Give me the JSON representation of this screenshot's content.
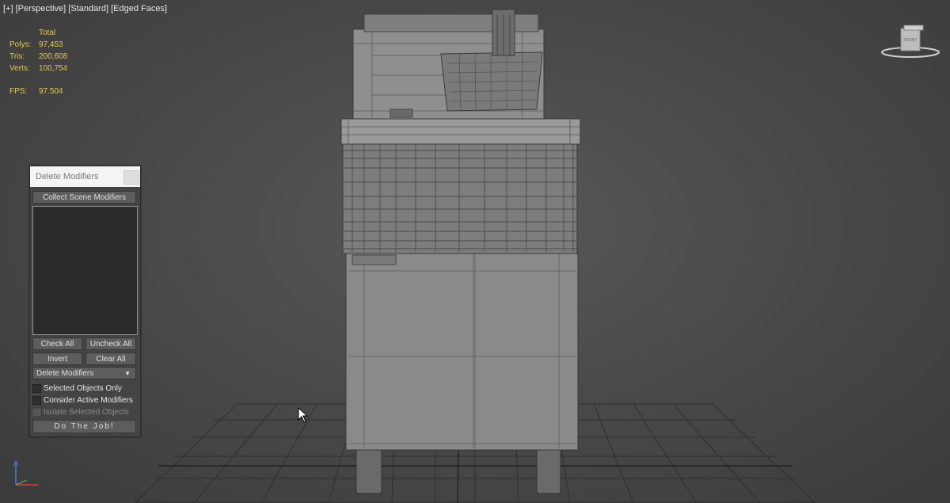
{
  "viewport": {
    "label_parts": [
      "[+]",
      "[Perspective]",
      "[Standard]",
      "[Edged Faces]"
    ]
  },
  "stats": {
    "header": "Total",
    "rows": [
      {
        "label": "Polys:",
        "value": "97,453"
      },
      {
        "label": "Tris:",
        "value": "200,608"
      },
      {
        "label": "Verts:",
        "value": "100,754"
      }
    ],
    "fps_label": "FPS:",
    "fps_value": "97.504"
  },
  "viewcube": {
    "face_label": "FRONT"
  },
  "panel": {
    "title": "Delete Modifiers",
    "collect_button": "Collect Scene Modifiers",
    "check_all": "Check All",
    "uncheck_all": "Uncheck All",
    "invert": "Invert",
    "clear_all": "Clear All",
    "mode_selected": "Delete Modifiers",
    "options": [
      {
        "label": "Selected Objects Only",
        "enabled": true
      },
      {
        "label": "Consider Active Modifiers",
        "enabled": true
      },
      {
        "label": "Isolate Selected Objects",
        "enabled": false
      }
    ],
    "do_job": "Do The Job!"
  },
  "colors": {
    "stats_text": "#e6c84a",
    "viewport_bg": "#4a4a4a",
    "panel_bg": "#444444"
  },
  "icons": [
    "viewcube-icon",
    "axis-gizmo-icon",
    "mouse-cursor-icon",
    "dropdown-arrow-icon",
    "close-icon"
  ]
}
